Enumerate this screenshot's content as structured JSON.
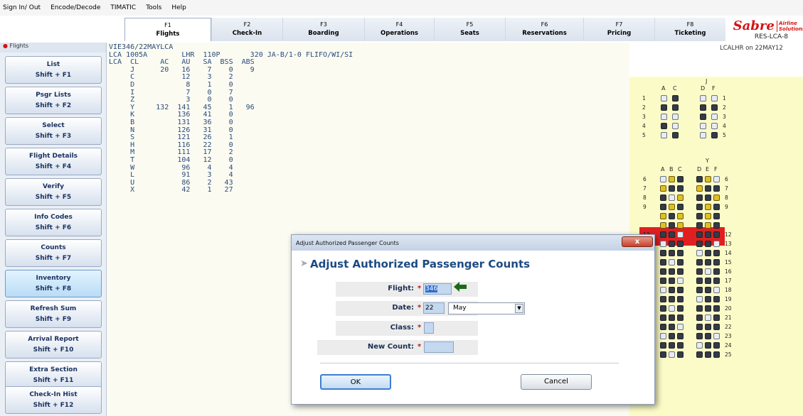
{
  "menu": [
    "Sign In/ Out",
    "Encode/Decode",
    "TIMATIC",
    "Tools",
    "Help"
  ],
  "function_tabs": [
    {
      "key": "F1",
      "label": "Flights",
      "active": true
    },
    {
      "key": "F2",
      "label": "Check-In"
    },
    {
      "key": "F3",
      "label": "Boarding"
    },
    {
      "key": "F4",
      "label": "Operations"
    },
    {
      "key": "F5",
      "label": "Seats"
    },
    {
      "key": "F6",
      "label": "Reservations"
    },
    {
      "key": "F7",
      "label": "Pricing"
    },
    {
      "key": "F8",
      "label": "Ticketing"
    }
  ],
  "logo": {
    "brand": "Sabre",
    "tagline": "Airline Solutions",
    "code": "RES-LCA-8"
  },
  "seatmap_title": "LCALHR on 22MAY12",
  "sidebar": {
    "header": "Flights",
    "buttons": [
      {
        "label": "List",
        "shortcut": "Shift + F1"
      },
      {
        "label": "Psgr Lists",
        "shortcut": "Shift + F2"
      },
      {
        "label": "Select",
        "shortcut": "Shift + F3"
      },
      {
        "label": "Flight Details",
        "shortcut": "Shift + F4"
      },
      {
        "label": "Verify",
        "shortcut": "Shift + F5"
      },
      {
        "label": "Info Codes",
        "shortcut": "Shift + F6"
      },
      {
        "label": "Counts",
        "shortcut": "Shift + F7"
      },
      {
        "label": "Inventory",
        "shortcut": "Shift + F8",
        "selected": true
      },
      {
        "label": "Refresh Sum",
        "shortcut": "Shift + F9"
      },
      {
        "label": "Arrival Report",
        "shortcut": "Shift + F10"
      },
      {
        "label": "Extra Section",
        "shortcut": "Shift + F11"
      },
      {
        "label": "Check-In Hist",
        "shortcut": "Shift + F12"
      }
    ]
  },
  "terminal_lines": [
    "VIE346/22MAYLCA",
    "LCA 1005A        LHR  110P       320 JA-B/1-0 FLIFO/WI/SI",
    "LCA  CL     AC   AU   SA  BSS  ABS",
    "     J      20   16    7    0    9",
    "     C           12    3    2",
    "     D            8    1    0",
    "     I            7    0    7",
    "     Z            3    0    0",
    "     Y     132  141   45    1   96",
    "     K          136   41    0",
    "     B          131   36    0",
    "     N          126   31    0",
    "     S          121   26    1",
    "     H          116   22    0",
    "     M          111   17    2",
    "     T          104   12    0",
    "     W           96    4    4",
    "     L           91    3    4",
    "     U           86    2   43",
    "     X           42    1   27"
  ],
  "seatmap": {
    "cabin_j": "J",
    "cabin_j_cols": [
      "A",
      "C",
      "D",
      "F"
    ],
    "cabin_y": "Y",
    "cabin_y_cols": [
      "A",
      "B",
      "C",
      "D",
      "E",
      "F"
    ],
    "j_rows": [
      "1",
      "2",
      "3",
      "4",
      "5"
    ],
    "y_rows": [
      "6",
      "7",
      "8",
      "9",
      "12",
      "13",
      "14",
      "15",
      "16",
      "17",
      "18",
      "19",
      "20",
      "21",
      "22",
      "23",
      "24",
      "25"
    ]
  },
  "dialog": {
    "window_title": "Adjust Authorized Passenger Counts",
    "heading": "Adjust Authorized Passenger Counts",
    "close_label": "x",
    "flight_label": "Flight:",
    "flight_value": "346",
    "date_label": "Date:",
    "date_day": "22",
    "date_month": "May",
    "class_label": "Class:",
    "class_value": "",
    "new_count_label": "New Count:",
    "new_count_value": "",
    "required_mark": "*",
    "ok_label": "OK",
    "cancel_label": "Cancel"
  }
}
